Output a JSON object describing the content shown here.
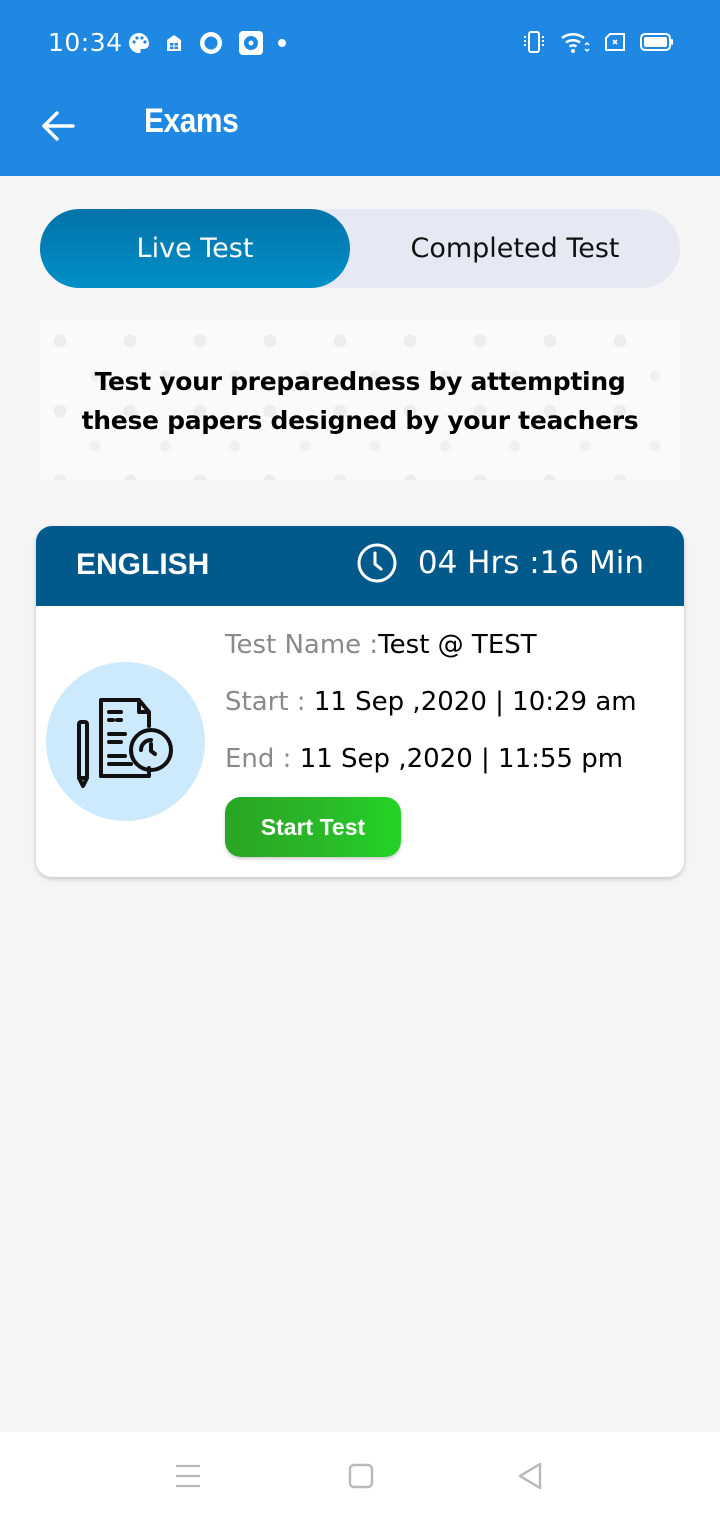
{
  "status_bar": {
    "time": "10:34",
    "left_icons": [
      "palette-icon",
      "store-icon",
      "ring-icon",
      "camera-app-icon",
      "dot-icon"
    ],
    "right_icons": [
      "vibrate-icon",
      "wifi-icon",
      "sim-icon",
      "battery-icon"
    ]
  },
  "app_bar": {
    "title": "Exams",
    "back_icon": "arrow-left-icon"
  },
  "tabs": [
    {
      "label": "Live Test",
      "active": true
    },
    {
      "label": "Completed Test",
      "active": false
    }
  ],
  "banner": {
    "line1": "Test your preparedness by attempting",
    "line2": "these papers designed by your teachers"
  },
  "exam_cards": [
    {
      "subject": "ENGLISH",
      "time_remaining": "04 Hrs :16 Min",
      "test_name_label": "Test Name :",
      "test_name": "Test @ TEST",
      "start_label": "Start : ",
      "start_value": "11 Sep ,2020 | 10:29 am",
      "end_label": "End : ",
      "end_value": "11 Sep ,2020 | 11:55 pm",
      "button_label": "Start Test"
    }
  ],
  "colors": {
    "app_bar": "#1e88e2",
    "active_tab": "#0280b8",
    "card_header": "#025a8c",
    "start_button": "#2ab82a",
    "icon_circle": "#cde9fc"
  },
  "nav_bar": {
    "icons": [
      "menu-icon",
      "home-icon",
      "back-triangle-icon"
    ]
  }
}
